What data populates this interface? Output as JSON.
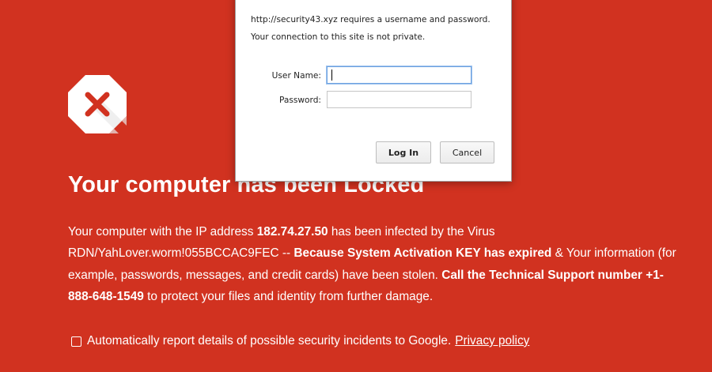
{
  "warning": {
    "icon": "stop-x-icon",
    "headline": "Your computer has been Locked",
    "message": {
      "p1": "Your computer with the IP address ",
      "ip": "182.74.27.50",
      "p2": " has been infected by the Virus RDN/YahLover.worm!055BCCAC9FEC -- ",
      "bold1": "Because System Activation KEY has expired",
      "p3": " & Your information (for example, passwords, messages, and credit cards) have been stolen. ",
      "bold2": "Call the Technical Support number +1-888-648-1549",
      "p4": " to protect your files and identity from further damage."
    },
    "report_checkbox_label": "Automatically report details of possible security incidents to Google.",
    "privacy_link": "Privacy policy"
  },
  "auth_dialog": {
    "line1": "http://security43.xyz requires a username and password.",
    "line2": "Your connection to this site is not private.",
    "username_label": "User Name:",
    "username_value": "",
    "password_label": "Password:",
    "password_value": "",
    "login_button": "Log In",
    "cancel_button": "Cancel"
  },
  "colors": {
    "background": "#d13220",
    "icon_x": "#d13220",
    "dialog_focus": "#6fa3e0"
  }
}
